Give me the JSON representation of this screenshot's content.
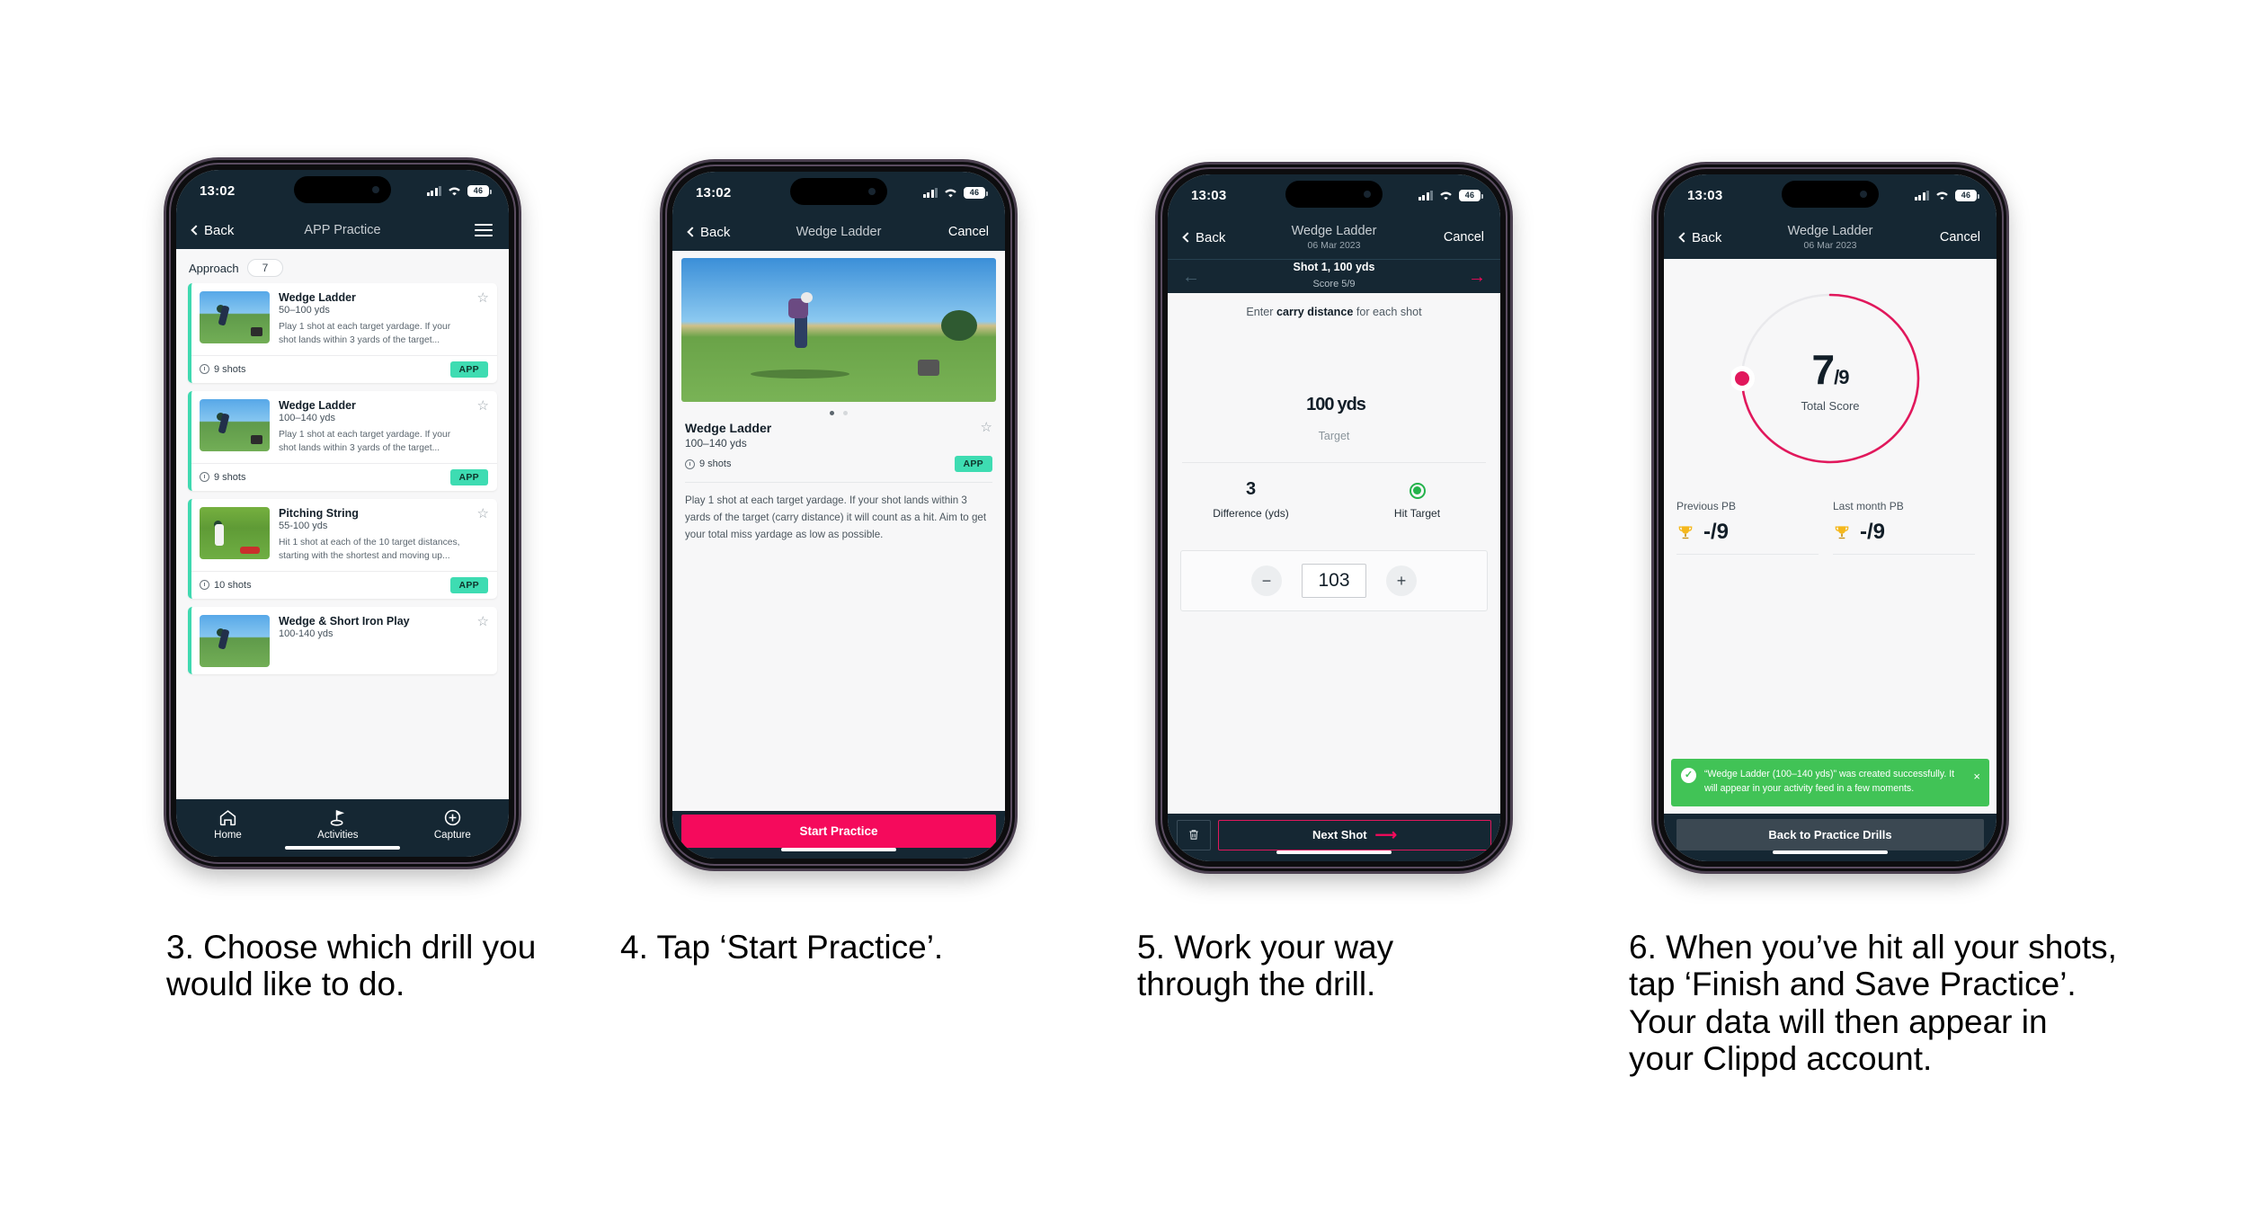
{
  "status_bar": {
    "time_1": "13:02",
    "time_2": "13:02",
    "time_3": "13:03",
    "time_4": "13:03",
    "battery": "46"
  },
  "colors": {
    "nav_dark": "#152733",
    "accent_pink": "#f50a5c",
    "accent_teal": "#3edcb2",
    "toast_green": "#41c356",
    "hit_green": "#24b34b"
  },
  "phone1": {
    "nav": {
      "back": "Back",
      "title": "APP Practice"
    },
    "filter": {
      "label": "Approach",
      "count": "7"
    },
    "cards": [
      {
        "title": "Wedge Ladder",
        "range": "50–100 yds",
        "desc": "Play 1 shot at each target yardage. If your shot lands within 3 yards of the target...",
        "shots": "9 shots",
        "tag": "APP"
      },
      {
        "title": "Wedge Ladder",
        "range": "100–140 yds",
        "desc": "Play 1 shot at each target yardage. If your shot lands within 3 yards of the target...",
        "shots": "9 shots",
        "tag": "APP"
      },
      {
        "title": "Pitching String",
        "range": "55-100 yds",
        "desc": "Hit 1 shot at each of the 10 target distances, starting with the shortest and moving up...",
        "shots": "10 shots",
        "tag": "APP"
      },
      {
        "title": "Wedge & Short Iron Play",
        "range": "100-140 yds",
        "desc": "",
        "shots": "",
        "tag": ""
      }
    ],
    "tabs": [
      {
        "label": "Home",
        "icon": "home-icon"
      },
      {
        "label": "Activities",
        "icon": "golf-flag-icon"
      },
      {
        "label": "Capture",
        "icon": "plus-circle-icon"
      }
    ]
  },
  "phone2": {
    "nav": {
      "back": "Back",
      "title": "Wedge Ladder",
      "cancel": "Cancel"
    },
    "detail": {
      "title": "Wedge Ladder",
      "range": "100–140 yds",
      "shots": "9 shots",
      "tag": "APP",
      "description": "Play 1 shot at each target yardage. If your shot lands within 3 yards of the target (carry distance) it will count as a hit. Aim to get your total miss yardage as low as possible."
    },
    "cta": "Start Practice"
  },
  "phone3": {
    "nav": {
      "back": "Back",
      "title": "Wedge Ladder",
      "date": "06 Mar 2023",
      "cancel": "Cancel"
    },
    "shotbar": {
      "shot": "Shot 1, 100 yds",
      "score": "Score 5/9"
    },
    "hint_before": "Enter ",
    "hint_bold": "carry distance",
    "hint_after": " for each shot",
    "target": {
      "value": "100",
      "unit": "yds",
      "label": "Target"
    },
    "stats": [
      {
        "value": "3",
        "label": "Difference (yds)"
      },
      {
        "value": "",
        "label": "Hit Target"
      }
    ],
    "stepper": {
      "minus": "−",
      "value": "103",
      "plus": "+"
    },
    "bottom": {
      "delete_icon": "trash-icon",
      "next": "Next Shot"
    }
  },
  "phone4": {
    "nav": {
      "back": "Back",
      "title": "Wedge Ladder",
      "date": "06 Mar 2023",
      "cancel": "Cancel"
    },
    "ring": {
      "score": "7",
      "denominator": "/9",
      "label": "Total Score",
      "progress_pct": 78
    },
    "pbs": [
      {
        "label": "Previous PB",
        "value": "-/9",
        "icon": "trophy-icon"
      },
      {
        "label": "Last month PB",
        "value": "-/9",
        "icon": "trophy-icon"
      }
    ],
    "toast": {
      "text": "“Wedge Ladder (100–140 yds)” was created successfully. It will appear in your activity feed in a few moments.",
      "close": "×"
    },
    "cta": "Back to Practice Drills"
  },
  "captions": {
    "step3": "3. Choose which drill you would like to do.",
    "step4": "4. Tap ‘Start Practice’.",
    "step5": "5. Work your way through the drill.",
    "step6": "6. When you’ve hit all your shots, tap ‘Finish and Save Practice’. Your data will then appear in your Clippd account."
  }
}
